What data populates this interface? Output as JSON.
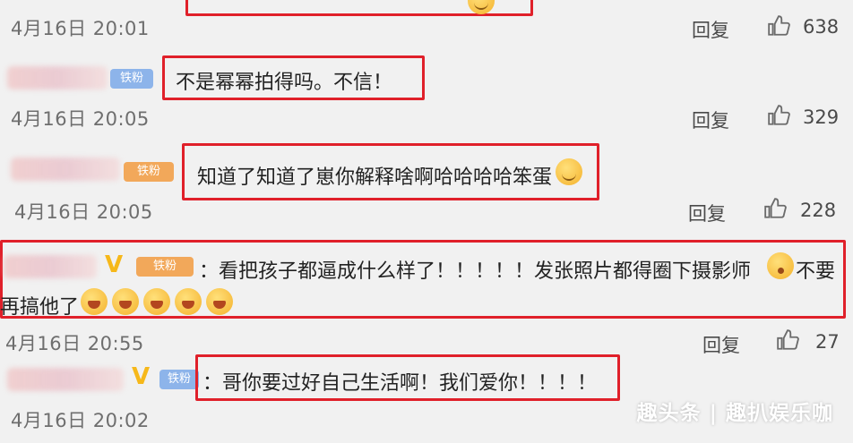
{
  "colors": {
    "highlight": "#e0202a",
    "badge_blue": "#8db4ea",
    "badge_orange": "#f2a85a",
    "vip": "#f6b81a"
  },
  "reply_label": "回复",
  "comments": [
    {
      "text": "",
      "time": "4月16日 20:01",
      "likes": "638"
    },
    {
      "badge": "铁粉",
      "text": "不是幂幂拍得吗。不信！",
      "time": "4月16日 20:05",
      "likes": "329"
    },
    {
      "badge": "铁粉",
      "text": "知道了知道了崽你解释啥啊哈哈哈哈笨蛋",
      "time": "4月16日 20:05",
      "likes": "228",
      "emoji": "smile-emoji"
    },
    {
      "vip": "V",
      "badge": "铁粉",
      "text_line1": "：看把孩子都逼成什么样了！！！！！发张照片都得圈下摄影师",
      "text_line1_tail": "不要",
      "text_line2": "再搞他了",
      "time": "4月16日 20:55",
      "likes": "27",
      "emoji": "crying-face-emoji"
    },
    {
      "vip": "V",
      "badge": "铁粉",
      "text": "：哥你要过好自己生活啊！我们爱你！！！！",
      "time": "4月16日 20:02"
    }
  ],
  "watermark": "趣头条 | 趣扒娱乐咖"
}
